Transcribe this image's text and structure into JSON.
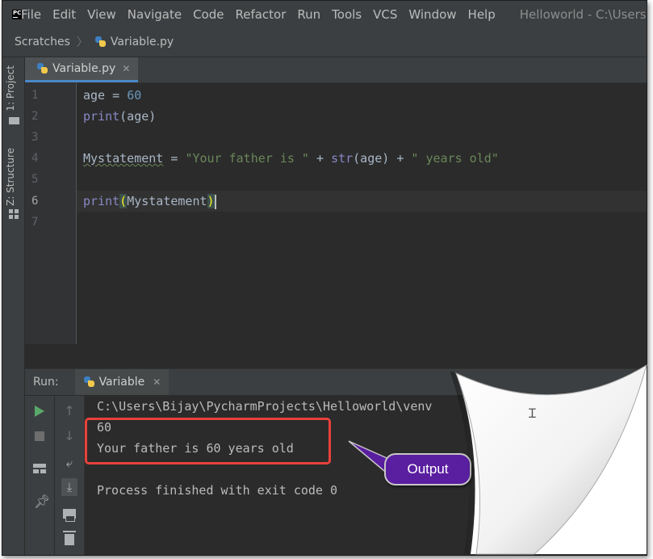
{
  "window": {
    "title": "Helloworld - C:\\Users\\"
  },
  "menu": {
    "items": [
      "File",
      "Edit",
      "View",
      "Navigate",
      "Code",
      "Refactor",
      "Run",
      "Tools",
      "VCS",
      "Window",
      "Help"
    ]
  },
  "app_icon": {
    "name": "pycharm-logo-icon",
    "label": "PC"
  },
  "breadcrumb": {
    "items": [
      "Scratches",
      "Variable.py"
    ]
  },
  "tool_windows": {
    "project": "1: Project",
    "structure": "Z: Structure"
  },
  "editor": {
    "tab_label": "Variable.py",
    "line_numbers": [
      "1",
      "2",
      "3",
      "4",
      "5",
      "6",
      "7"
    ],
    "current_line": 6,
    "lines": {
      "l1": {
        "var": "age",
        "op": " = ",
        "num": "60"
      },
      "l2": {
        "fn": "print",
        "rest": "(age)"
      },
      "l4": {
        "var": "Mystatement",
        "op1": " = ",
        "s1": "\"Your father is \"",
        "op2": " + ",
        "fn": "str",
        "mid": "(age)",
        "op3": " + ",
        "s2": "\" years old\""
      },
      "l6": {
        "fn": "print",
        "open": "(",
        "arg": "Mystatement",
        "close": ")"
      }
    }
  },
  "run_panel": {
    "label": "Run:",
    "tab_label": "Variable",
    "output": [
      "C:\\Users\\Bijay\\PycharmProjects\\Helloworld\\venv",
      "60",
      "Your father is 60 years old",
      "",
      "Process finished with exit code 0"
    ]
  },
  "annotation": {
    "callout_label": "Output",
    "box_color": "#e8413b",
    "callout_color": "#5a1ea0"
  },
  "colors": {
    "background": "#2b2b2b",
    "chrome": "#3c3f41",
    "keyword_number": "#6897bb",
    "builtin": "#8888c6",
    "string": "#6a8759",
    "run_green": "#59a869"
  }
}
